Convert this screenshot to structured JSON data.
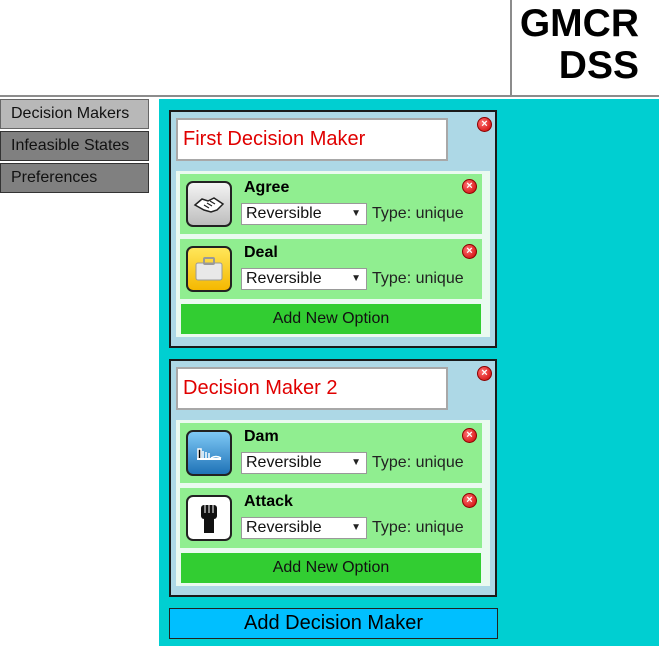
{
  "app": {
    "logo_line1": "GMCR",
    "logo_line2": "DSS"
  },
  "sidebar": {
    "items": [
      {
        "label": "Decision Makers"
      },
      {
        "label": "Infeasible States"
      },
      {
        "label": "Preferences"
      }
    ]
  },
  "decision_makers": [
    {
      "name": "First Decision Maker",
      "options": [
        {
          "name": "Agree",
          "icon": "handshake-icon",
          "reversibility": "Reversible",
          "type": "Type: unique"
        },
        {
          "name": "Deal",
          "icon": "briefcase-icon",
          "reversibility": "Reversible",
          "type": "Type: unique"
        }
      ],
      "add_option_label": "Add New Option"
    },
    {
      "name": "Decision Maker 2",
      "options": [
        {
          "name": "Dam",
          "icon": "dam-icon",
          "reversibility": "Reversible",
          "type": "Type: unique"
        },
        {
          "name": "Attack",
          "icon": "fist-icon",
          "reversibility": "Reversible",
          "type": "Type: unique"
        }
      ],
      "add_option_label": "Add New Option"
    }
  ],
  "add_decision_maker_label": "Add Decision Maker",
  "colors": {
    "main_bg": "#00cfd1",
    "dm_box_bg": "#add8e6",
    "option_bg": "#90ee90",
    "add_option_bg": "#32cd32",
    "add_dm_bg": "#00bfff",
    "dm_name_text": "#e00000"
  }
}
